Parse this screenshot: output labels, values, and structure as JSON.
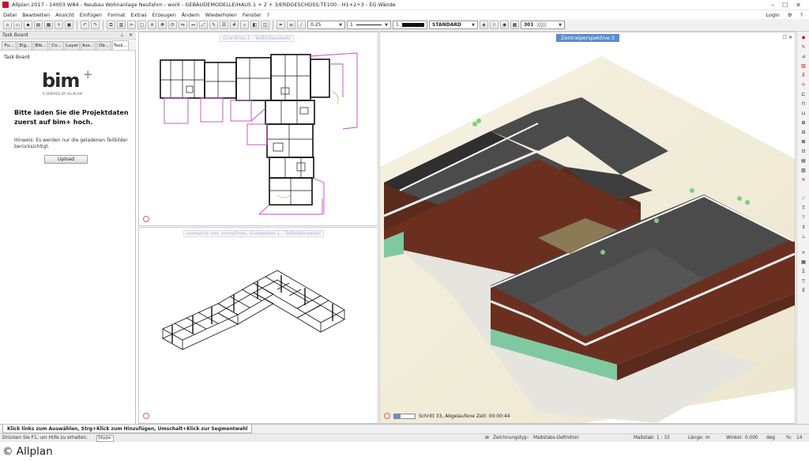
{
  "window": {
    "title": "Allplan 2017 - 14003 W84 - Neubau Wohnanlage Neufahrn - work - GEBÄUDEMODELLE/HAUS 1 + 2 + 3/ERDGESCHOSS:TE100 - H1+2+3 - EG Wände",
    "login_label": "Login"
  },
  "menu": {
    "items": [
      "Datei",
      "Bearbeiten",
      "Ansicht",
      "Einfügen",
      "Format",
      "Extras",
      "Erzeugen",
      "Ändern",
      "Wiederholen",
      "Fenster",
      "?"
    ]
  },
  "toolbar": {
    "pen_value": "0.25",
    "line_value": "1",
    "color_value": "1",
    "layer_value": "STANDARD",
    "hatch_value": "301"
  },
  "task_board": {
    "header": "Task Board",
    "tabs": [
      "Fu...",
      "Eig...",
      "Bib...",
      "Co...",
      "Layer",
      "Ass...",
      "Ob...",
      "Task..."
    ],
    "label": "Task Board",
    "logo_text": "bim",
    "logo_plus": "+",
    "logo_sub": "A SERVICE BY ALLPLAN",
    "heading": "Bitte laden Sie die Projektdaten zuerst auf bim+ hoch.",
    "hint": "Hinweis: Es werden nur die geladenen Teilbilder berücksichtigt.",
    "upload_label": "Upload"
  },
  "viewports": {
    "plan_title": "Grundriss 2 - Teilbildauswahl",
    "iso_title": "Isometrie von vorne/links, Südwesten 1 - Teilbildauswahl",
    "persp_title": "Zentralperspektive 3",
    "render_status": "Schritt 33, Abgelaufene Zeit: 00:00:44",
    "render_progress": 0.3
  },
  "hint_bar": {
    "text": "Klick links zum Auswählen, Strg+Klick zum Hinzufügen, Umschalt+Klick zur Segmentwahl"
  },
  "status_bar": {
    "help_text": "Drücken Sie F1, um Hilfe zu erhalten.",
    "skype_label": "Skype",
    "drawing_type_label": "Zeichnungstyp:",
    "drawing_type_value": "Maßstabs-Definition",
    "scale_label": "Maßstab:",
    "scale_value": "1 : 33",
    "length_label": "Länge:",
    "length_value": "m",
    "angle_label": "Winkel:",
    "angle_value": "0.000",
    "angle_unit": "deg",
    "percent_label": "%:",
    "percent_value": "14"
  },
  "footer": {
    "copyright": "© Allplan"
  },
  "colors": {
    "accent_blue": "#5b8bd0",
    "plan_magenta": "#cc44cc",
    "roof_dark": "#4b4b4b",
    "facade_brown": "#6b2f1f",
    "glass_green": "#7fc9a0"
  }
}
